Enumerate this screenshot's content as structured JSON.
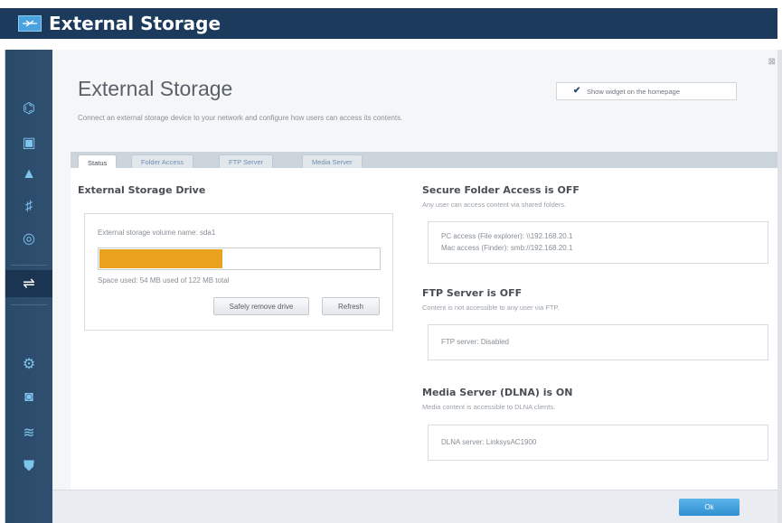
{
  "header": {
    "title": "External Storage",
    "icon": "usb-storage-icon"
  },
  "sidebar": {
    "items": [
      {
        "name": "network-map",
        "icon": "network-icon",
        "glyph": "⌬"
      },
      {
        "name": "guest-access",
        "icon": "briefcase-icon",
        "glyph": "▣"
      },
      {
        "name": "parental-controls",
        "icon": "warning-icon",
        "glyph": "▲"
      },
      {
        "name": "media-prioritization",
        "icon": "media-icon",
        "glyph": "♯"
      },
      {
        "name": "speed-test",
        "icon": "speedometer-icon",
        "glyph": "◎"
      },
      {
        "name": "external-storage",
        "icon": "usb-icon",
        "glyph": "⇌",
        "active": true
      },
      {
        "name": "connectivity",
        "icon": "gears-icon",
        "glyph": "⚙"
      },
      {
        "name": "troubleshooting",
        "icon": "camera-icon",
        "glyph": "◙"
      },
      {
        "name": "wireless",
        "icon": "wifi-icon",
        "glyph": "≋"
      },
      {
        "name": "security",
        "icon": "shield-icon",
        "glyph": "⛊"
      }
    ]
  },
  "page": {
    "heading": "External Storage",
    "description": "Connect an external storage device to your network and configure how users can access its contents.",
    "widget_checkbox_label": "Show widget on the homepage",
    "widget_checked": true
  },
  "tabs": [
    {
      "label": "Status",
      "active": true
    },
    {
      "label": "Folder Access",
      "active": false
    },
    {
      "label": "FTP Server",
      "active": false
    },
    {
      "label": "Media Server",
      "active": false
    }
  ],
  "drive": {
    "title": "External Storage Drive",
    "volume_label": "External storage volume name: sda1",
    "used_fraction": 0.44,
    "space_text": "Space used: 54 MB used of 122 MB total",
    "remove_button": "Safely remove drive",
    "refresh_button": "Refresh"
  },
  "secure_folder": {
    "title": "Secure Folder Access is OFF",
    "subtitle": "Any user can access content via shared folders.",
    "pc_access": "PC access (File explorer): \\\\192.168.20.1",
    "mac_access": "Mac access (Finder): smb://192.168.20.1"
  },
  "ftp": {
    "title": "FTP Server is OFF",
    "subtitle": "Content is not accessible to any user via FTP.",
    "status": "FTP server: Disabled"
  },
  "media": {
    "title": "Media Server (DLNA) is ON",
    "subtitle": "Media content is accessible to DLNA clients.",
    "status": "DLNA server: LinksysAC1900"
  },
  "footer": {
    "ok_label": "Ok"
  },
  "colors": {
    "header_bg": "#1b3a5c",
    "sidebar_bg": "#2a4a6a",
    "progress_fill": "#e8a21e",
    "ok_button": "#2f8fd0"
  }
}
